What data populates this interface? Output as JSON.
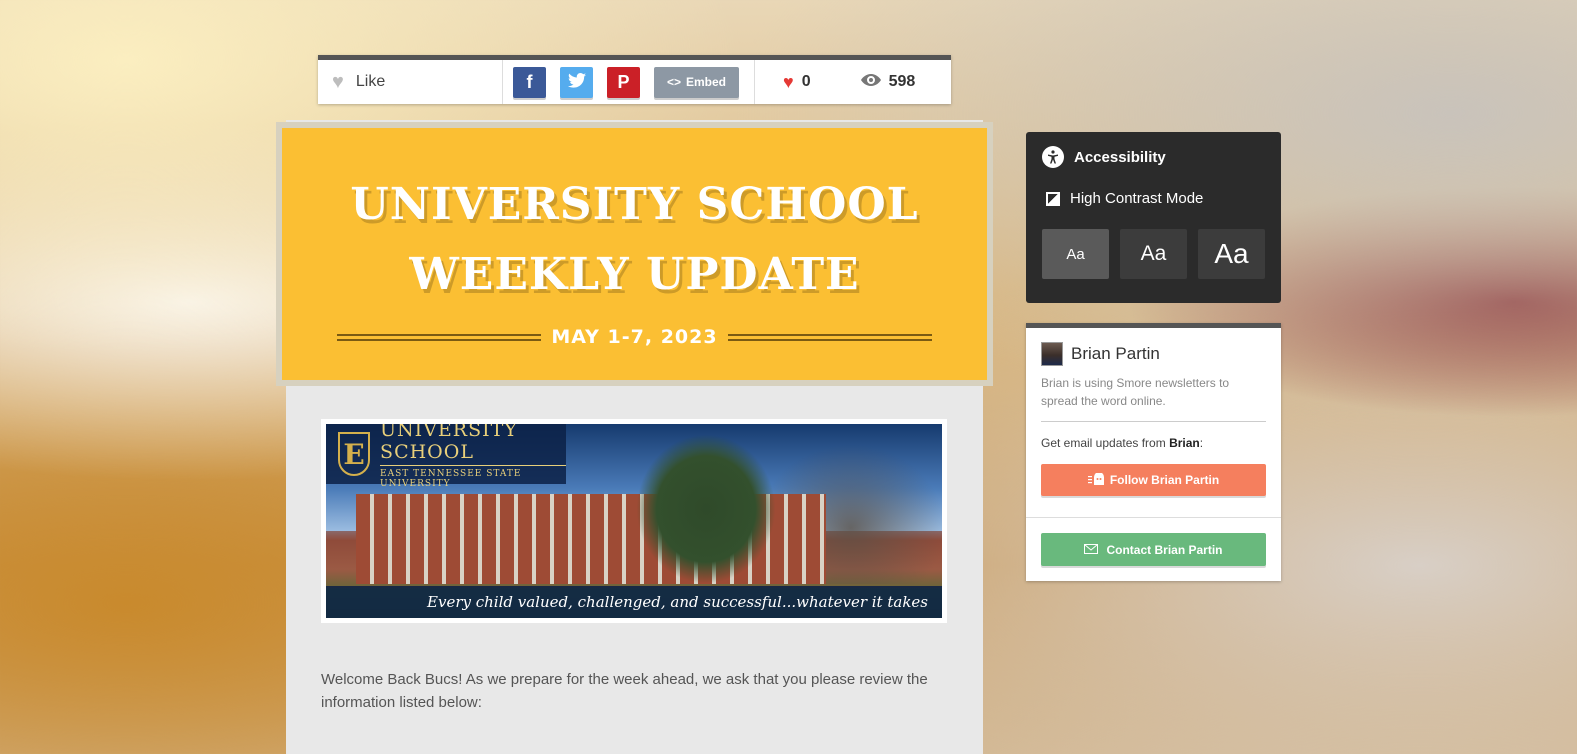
{
  "share_bar": {
    "like_label": "Like",
    "facebook_glyph": "f",
    "twitter_glyph": "t",
    "pinterest_glyph": "P",
    "embed_label": "Embed",
    "likes_count": "0",
    "views_count": "598"
  },
  "banner": {
    "title_line1": "UNIVERSITY SCHOOL",
    "title_line2": "WEEKLY UPDATE",
    "date": "MAY 1-7, 2023"
  },
  "hero": {
    "logo_letter": "E",
    "logo_title": "UNIVERSITY SCHOOL",
    "logo_subtitle": "EAST TENNESSEE STATE UNIVERSITY",
    "tagline": "Every child valued, challenged, and successful...whatever it takes"
  },
  "intro_text": "Welcome Back Bucs! As we prepare for the week ahead, we ask that you please review the information listed below:",
  "accessibility": {
    "title": "Accessibility",
    "high_contrast_label": "High Contrast Mode",
    "size_small": "Aa",
    "size_medium": "Aa",
    "size_large": "Aa"
  },
  "author": {
    "name": "Brian Partin",
    "description": "Brian is using Smore newsletters to spread the word online.",
    "updates_prefix": "Get email updates from ",
    "updates_name": "Brian",
    "updates_suffix": ":",
    "follow_label": "Follow Brian Partin",
    "contact_label": "Contact Brian Partin"
  },
  "colors": {
    "banner_yellow": "#fbbf33",
    "follow_orange": "#f57f5e",
    "contact_green": "#69b97d",
    "facebook": "#3b5998",
    "twitter": "#55acee",
    "pinterest": "#cb2027"
  }
}
